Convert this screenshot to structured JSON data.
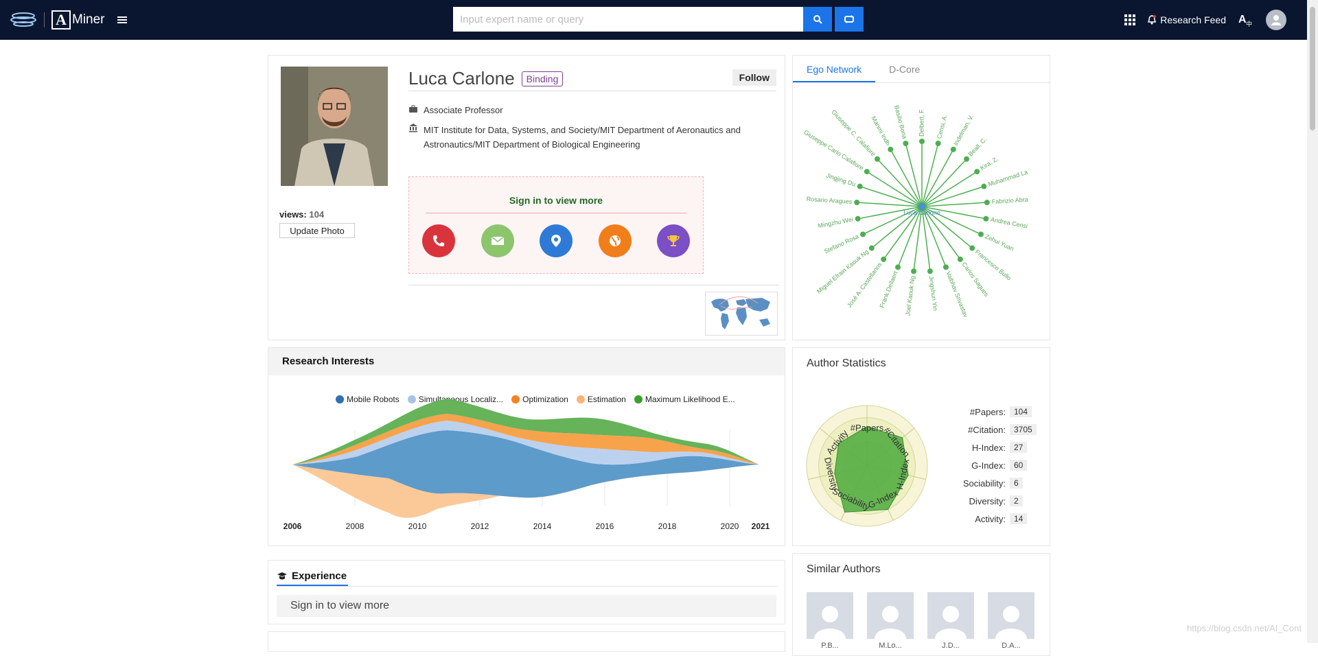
{
  "nav": {
    "logo_text": "Miner",
    "logo_letter": "A",
    "search_placeholder": "Input expert name or query",
    "research_feed": "Research Feed"
  },
  "profile": {
    "name": "Luca Carlone",
    "binding_label": "Binding",
    "follow_label": "Follow",
    "position": "Associate Professor",
    "affiliation_line1": "MIT Institute for Data, Systems, and Society/MIT Department of Aeronautics and",
    "affiliation_line2": "Astronautics/MIT Department of Biological Engineering",
    "views_label": "views:",
    "views": "104",
    "update_photo": "Update Photo",
    "signin_text": "Sign in to view more",
    "contact_icons": [
      {
        "name": "phone-icon",
        "color": "#d9343b"
      },
      {
        "name": "mail-icon",
        "color": "#8cc56c"
      },
      {
        "name": "location-icon",
        "color": "#2f7ad6"
      },
      {
        "name": "globe-icon",
        "color": "#f07e1b"
      },
      {
        "name": "trophy-icon",
        "color": "#7b4fc6"
      }
    ]
  },
  "ego": {
    "tabs": [
      "Ego Network",
      "D-Core"
    ],
    "center": "Luca Carlone",
    "nodes": [
      "Delbert, F.",
      "Censi, A.",
      "Indelman, V.",
      "Beall, C.",
      "Kira, Z.",
      "Muhammad La",
      "Fabrizio Abra",
      "Andrea Censi",
      "Zehui Yuan",
      "Francesco Bullo",
      "Carlos Sagues",
      "Vaibhav Srivastav",
      "Jingshun Yin",
      "Joel Kaouk Ng",
      "Frank Dellaert",
      "José A. Castellanos",
      "Miguel Efrain Kaouk Ng",
      "Stefano Rosa",
      "Mingzhu Wei",
      "Rosario Aragues",
      "Jingjing Du",
      "Giuseppe Carlo Calafiore",
      "Giuseppe C. Calafiore",
      "Manmi Indh",
      "Basilio Bona"
    ]
  },
  "research": {
    "title": "Research Interests",
    "legend": [
      {
        "label": "Mobile Robots",
        "color": "#2f6fb2"
      },
      {
        "label": "Simultaneous Localiz...",
        "color": "#a9c3e6"
      },
      {
        "label": "Optimization",
        "color": "#f58220"
      },
      {
        "label": "Estimation",
        "color": "#fbb479"
      },
      {
        "label": "Maximum Likelihood E...",
        "color": "#3aa02b"
      }
    ],
    "years": [
      "2006",
      "2008",
      "2010",
      "2012",
      "2014",
      "2016",
      "2018",
      "2020",
      "2021"
    ]
  },
  "stats": {
    "title": "Author Statistics",
    "radar_labels": [
      "#Papers",
      "#Citation",
      "H-Index",
      "G-Index",
      "Sociability",
      "Diversity",
      "Activity"
    ],
    "rows": [
      {
        "k": "#Papers:",
        "v": "104"
      },
      {
        "k": "#Citation:",
        "v": "3705"
      },
      {
        "k": "H-Index:",
        "v": "27"
      },
      {
        "k": "G-Index:",
        "v": "60"
      },
      {
        "k": "Sociability:",
        "v": "6"
      },
      {
        "k": "Diversity:",
        "v": "2"
      },
      {
        "k": "Activity:",
        "v": "14"
      }
    ]
  },
  "experience": {
    "title": "Experience",
    "body": "Sign in to view more"
  },
  "similar": {
    "title": "Similar Authors",
    "names": [
      "P.B...",
      "M.Lo...",
      "J.D...",
      "D.A..."
    ]
  },
  "watermark": "https://blog.csdn.net/AI_Cont"
}
